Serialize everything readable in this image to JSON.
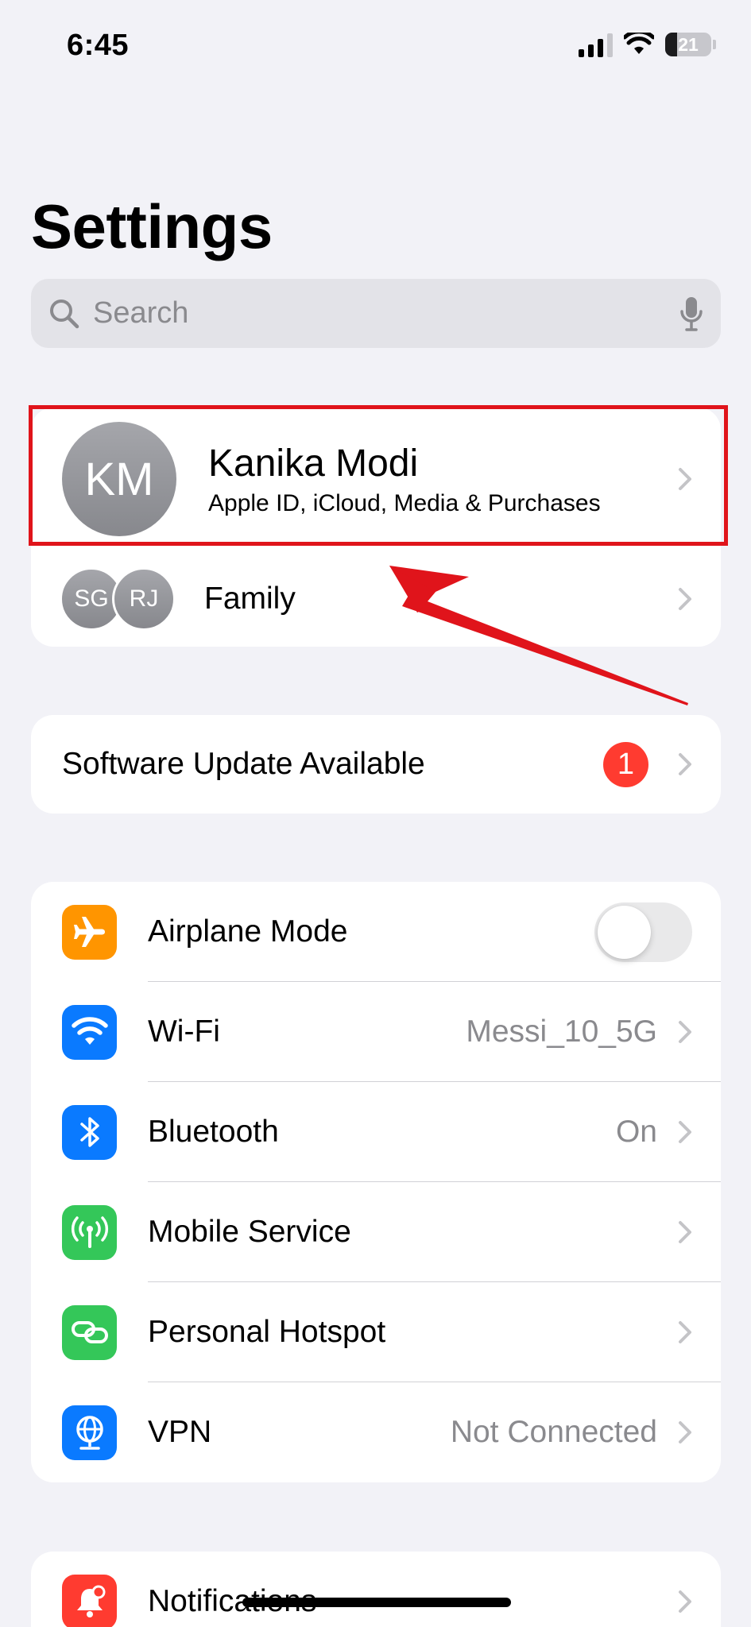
{
  "status_bar": {
    "time": "6:45",
    "battery": "21"
  },
  "header": {
    "title": "Settings"
  },
  "search": {
    "placeholder": "Search"
  },
  "profile": {
    "initials": "KM",
    "name": "Kanika Modi",
    "subtitle": "Apple ID, iCloud, Media & Purchases"
  },
  "family": {
    "avatars": [
      "SG",
      "RJ"
    ],
    "label": "Family"
  },
  "software_update": {
    "label": "Software Update Available",
    "badge": "1"
  },
  "connectivity": [
    {
      "label": "Airplane Mode",
      "icon": "airplane-icon",
      "color": "#ff9500",
      "toggle": false
    },
    {
      "label": "Wi-Fi",
      "value": "Messi_10_5G",
      "icon": "wifi-icon",
      "color": "#0a7aff"
    },
    {
      "label": "Bluetooth",
      "value": "On",
      "icon": "bluetooth-icon",
      "color": "#0a7aff"
    },
    {
      "label": "Mobile Service",
      "icon": "antenna-icon",
      "color": "#34c759"
    },
    {
      "label": "Personal Hotspot",
      "icon": "hotspot-link-icon",
      "color": "#34c759"
    },
    {
      "label": "VPN",
      "value": "Not Connected",
      "icon": "globe-icon",
      "color": "#0a7aff"
    }
  ],
  "notifications": {
    "label": "Notifications",
    "icon": "bell-icon",
    "color": "#ff3b30"
  },
  "annotation": {
    "highlight_color": "#e0141b",
    "target": "profile"
  }
}
